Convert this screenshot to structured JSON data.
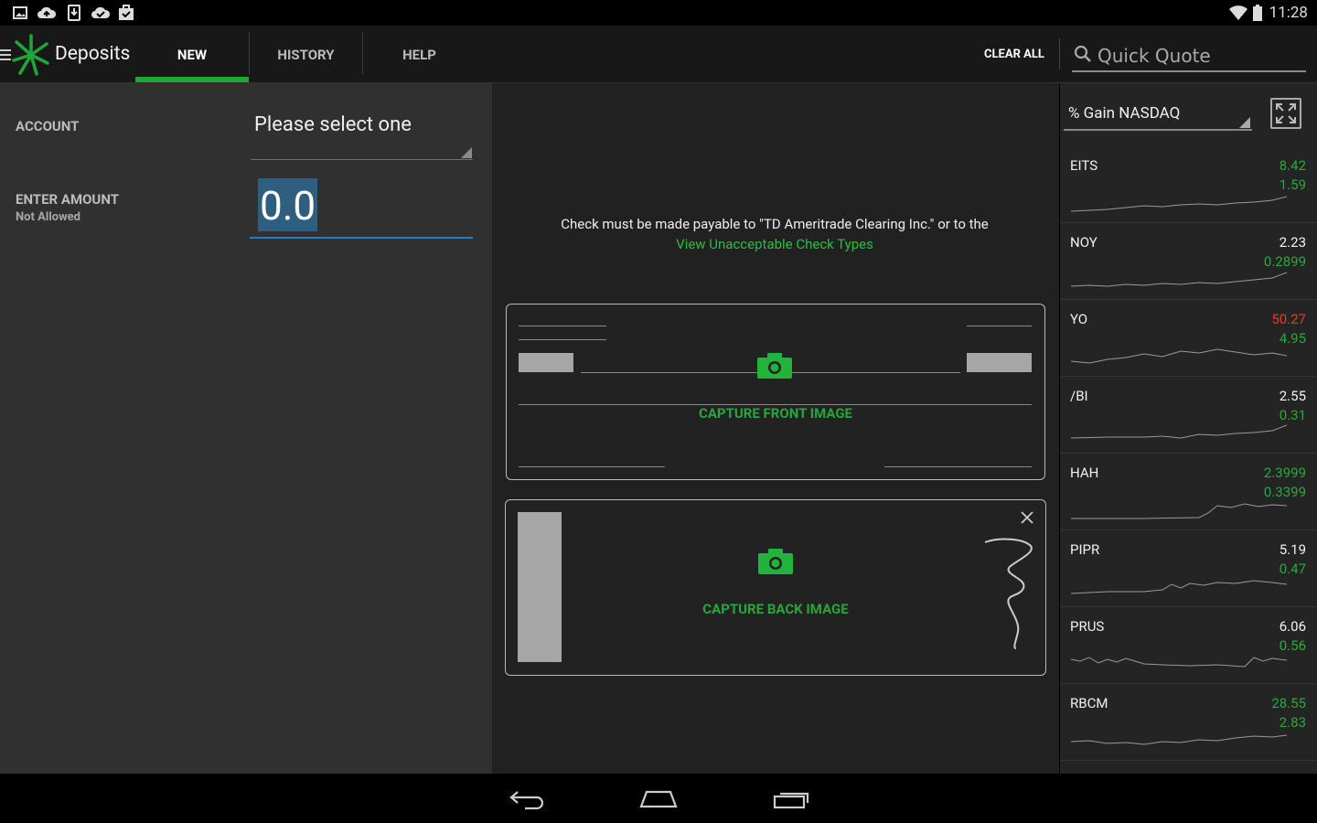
{
  "status_bar": {
    "time": "11:28",
    "notification_icons": [
      "image-icon",
      "cloud-upload-icon",
      "download-icon",
      "cloud-check-icon",
      "briefcase-check-icon"
    ],
    "system_icons": [
      "wifi-icon",
      "battery-icon"
    ]
  },
  "app_bar": {
    "title": "Deposits",
    "tabs": [
      {
        "label": "NEW",
        "active": true
      },
      {
        "label": "HISTORY",
        "active": false
      },
      {
        "label": "HELP",
        "active": false
      }
    ],
    "clear_all": "CLEAR ALL",
    "quick_quote_placeholder": "Quick Quote"
  },
  "form": {
    "account_label": "ACCOUNT",
    "account_value": "Please select one",
    "amount_label": "ENTER AMOUNT",
    "amount_sublabel": "Not Allowed",
    "amount_value": "0.0"
  },
  "center": {
    "message": "Check must be made payable to \"TD Ameritrade Clearing Inc.\" or to the",
    "link": "View Unacceptable Check Types",
    "front_label": "CAPTURE FRONT IMAGE",
    "back_label": "CAPTURE BACK IMAGE"
  },
  "watchlist": {
    "selector": "% Gain NASDAQ",
    "items": [
      {
        "symbol": "EITS",
        "price": "8.42",
        "change": "1.59",
        "price_color": "#2aa83d"
      },
      {
        "symbol": "NOY",
        "price": "2.23",
        "change": "0.2899",
        "price_color": "#f2f2f2"
      },
      {
        "symbol": "YO",
        "price": "50.27",
        "change": "4.95",
        "price_color": "#e53935"
      },
      {
        "symbol": "/BI",
        "price": "2.55",
        "change": "0.31",
        "price_color": "#f2f2f2"
      },
      {
        "symbol": "HAH",
        "price": "2.3999",
        "change": "0.3399",
        "price_color": "#2aa83d"
      },
      {
        "symbol": "PIPR",
        "price": "5.19",
        "change": "0.47",
        "price_color": "#f2f2f2"
      },
      {
        "symbol": "PRUS",
        "price": "6.06",
        "change": "0.56",
        "price_color": "#f2f2f2"
      },
      {
        "symbol": "RBCM",
        "price": "28.55",
        "change": "2.83",
        "price_color": "#2aa83d"
      }
    ]
  },
  "colors": {
    "accent_green": "#1fa83a",
    "negative_red": "#e53935",
    "focus_blue": "#1e7fc4"
  }
}
